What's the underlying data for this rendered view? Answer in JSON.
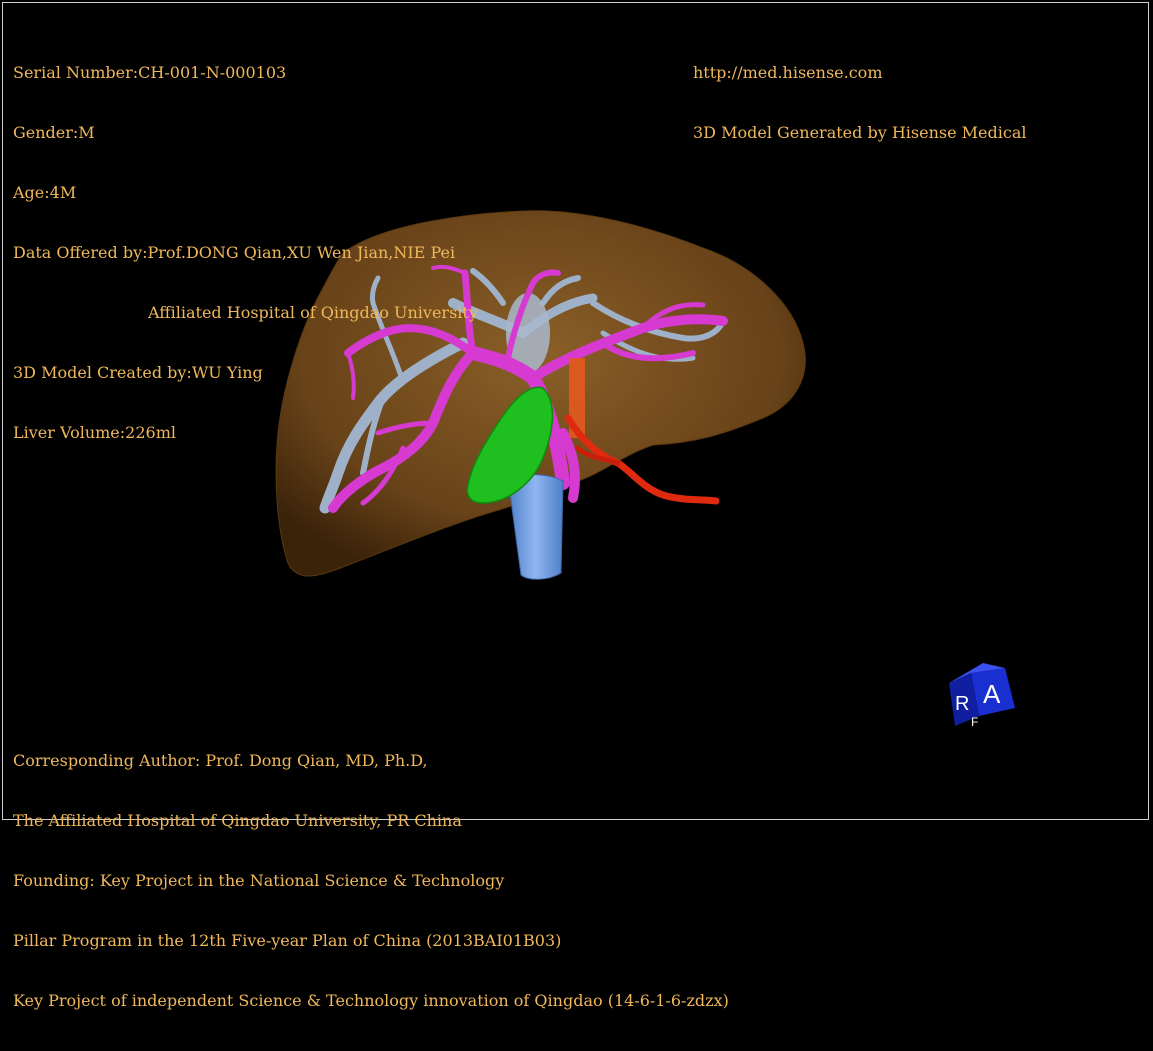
{
  "info": {
    "serial": "Serial Number:CH-001-N-000103",
    "gender": "Gender:M",
    "age": "Age:4M",
    "data_offered": "Data Offered by:Prof.DONG Qian,XU Wen Jian,NIE Pei",
    "hospital": "Affiliated Hospital of Qingdao University",
    "created_by": "3D Model Created by:WU Ying",
    "liver_volume": "Liver Volume:226ml"
  },
  "link": {
    "url": "http://med.hisense.com",
    "generator": "3D Model Generated by Hisense Medical"
  },
  "footer": {
    "line1": "Corresponding Author: Prof. Dong Qian, MD, Ph.D,",
    "line2": "The Affiliated Hospital of Qingdao University, PR China",
    "line3": "Founding: Key Project in the National Science & Technology",
    "line4": "Pillar Program in the 12th Five-year Plan of China (2013BAI01B03)",
    "line5": "Key Project of independent Science & Technology innovation of Qingdao (14-6-1-6-zdzx)"
  },
  "cube": {
    "face_front": "A",
    "face_side": "R",
    "face_bottom": "F"
  },
  "colors": {
    "text": "#f0b85a",
    "liver": "#8a5a22",
    "portal_vein": "#d63ad0",
    "hepatic_vein": "#9fb1c8",
    "gallbladder": "#1fbf1f",
    "ivc": "#6d9be0",
    "artery": "#e02a10",
    "cube": "#1a2fd0"
  }
}
